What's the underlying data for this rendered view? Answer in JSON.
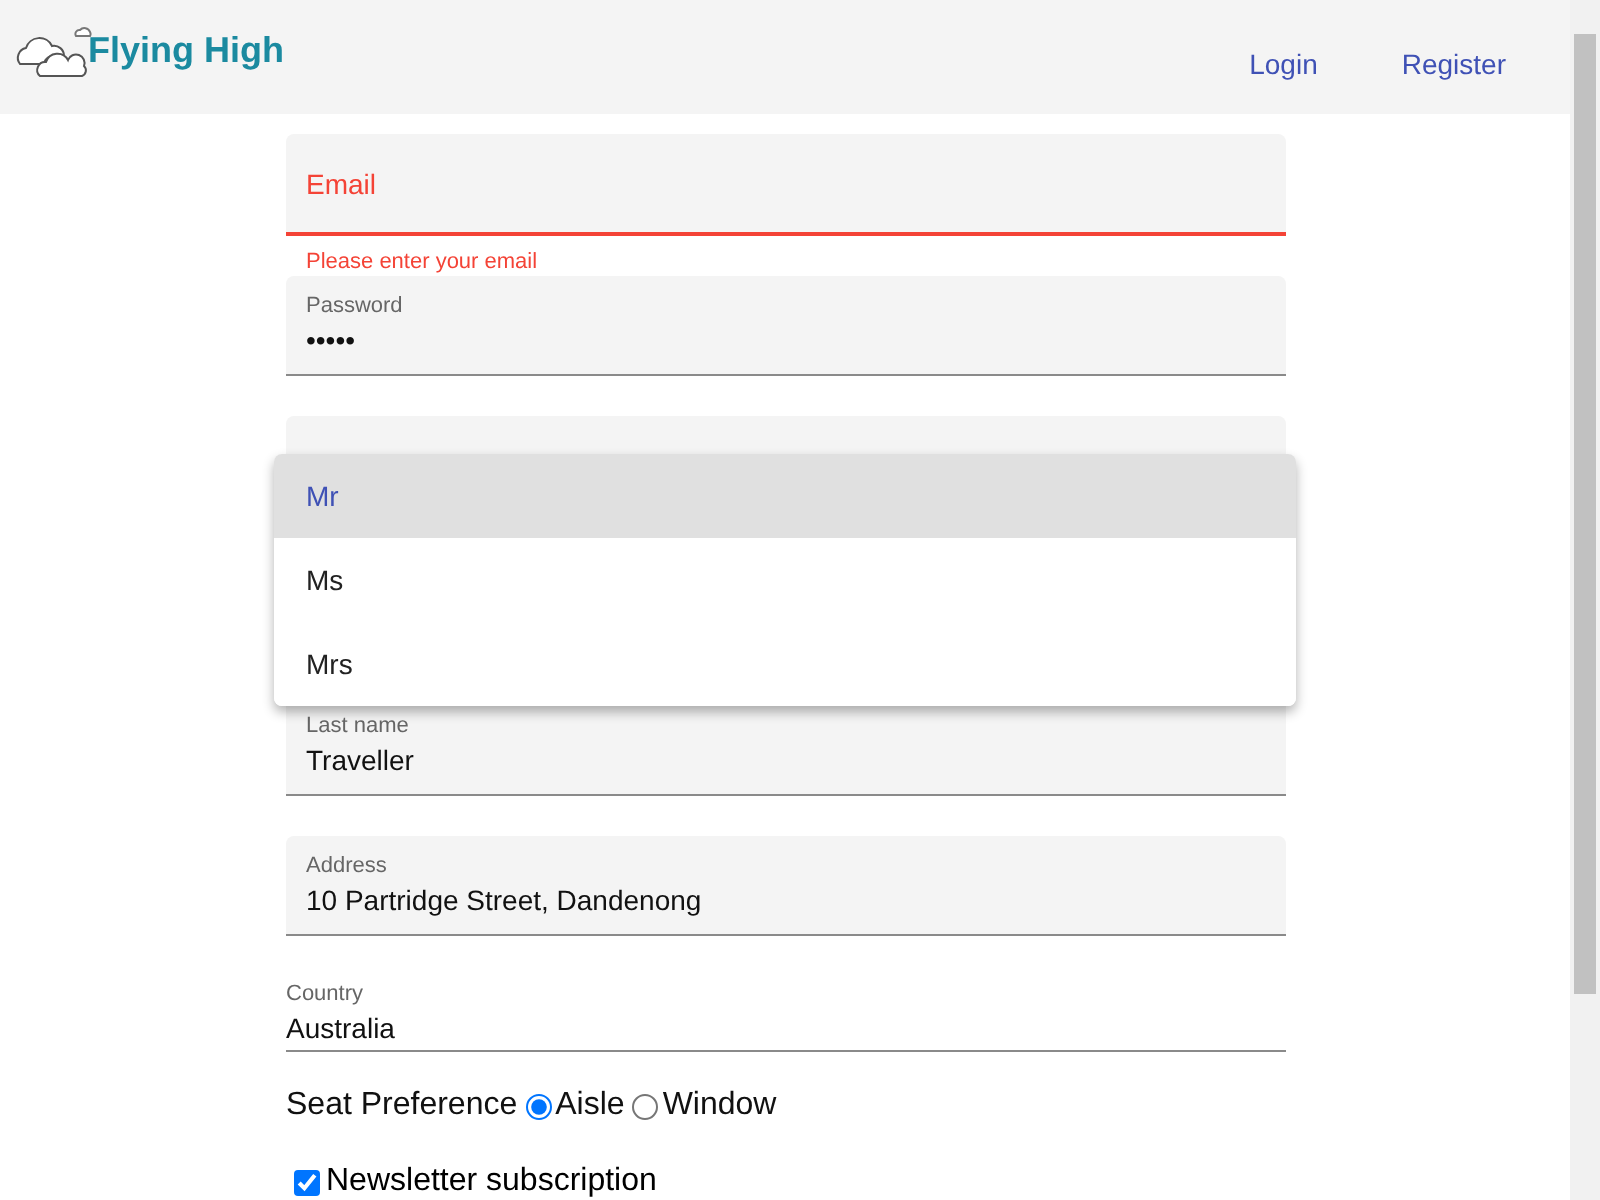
{
  "header": {
    "logo_text": "Flying High",
    "nav": [
      {
        "label": "Login"
      },
      {
        "label": "Register"
      }
    ]
  },
  "fields": [
    {
      "kind": "filled",
      "label": "Email",
      "error": "Please enter your email"
    },
    {
      "kind": "filled",
      "label": "Password",
      "value": "•••••"
    },
    {
      "kind": "select"
    },
    {
      "kind": "filled",
      "label": "Last name",
      "value": "Traveller"
    },
    {
      "kind": "filled",
      "label": "Address",
      "value": "10 Partridge Street, Dandenong"
    },
    {
      "kind": "standard",
      "label": "Country",
      "value": "Australia"
    }
  ],
  "seat_preference": {
    "label": "Seat Preference",
    "options": [
      {
        "label": "Aisle",
        "selected": true
      },
      {
        "label": "Window",
        "selected": false
      }
    ]
  },
  "newsletter": {
    "label": "Newsletter subscription",
    "checked": true
  },
  "title_menu": {
    "items": [
      {
        "label": "Mr",
        "selected": true
      },
      {
        "label": "Ms",
        "selected": false
      },
      {
        "label": "Mrs",
        "selected": false
      }
    ]
  }
}
